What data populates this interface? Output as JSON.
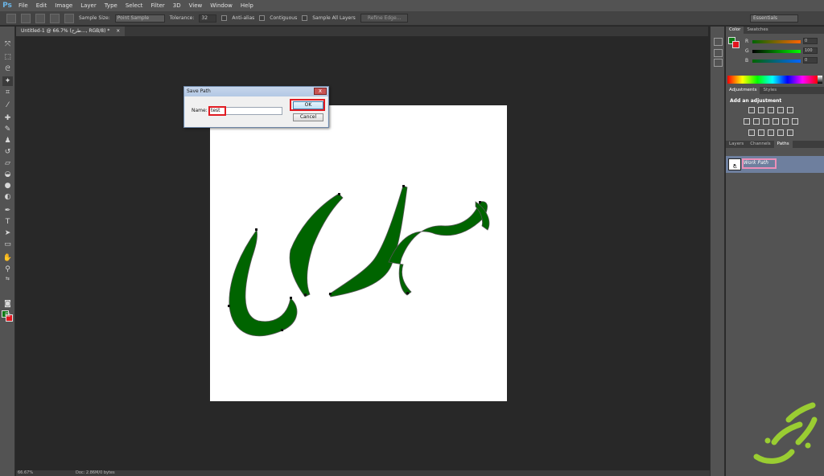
{
  "app": {
    "logo": "Ps",
    "menu": [
      "File",
      "Edit",
      "Image",
      "Layer",
      "Type",
      "Select",
      "Filter",
      "3D",
      "View",
      "Window",
      "Help"
    ]
  },
  "options_bar": {
    "sample_size_label": "Sample Size:",
    "sample_size_value": "Point Sample",
    "tolerance_label": "Tolerance:",
    "tolerance_value": "32",
    "antialias_label": "Anti-alias",
    "contiguous_label": "Contiguous",
    "sample_all_label": "Sample All Layers",
    "refine_edge_label": "Refine Edge...",
    "workspace": "Essentials"
  },
  "document": {
    "tab_title": "Untitled-1 @ 66.7% (طرح..., RGB/8) *",
    "close_glyph": "×",
    "artwork_text": "معماری",
    "artwork_color": "#006400"
  },
  "dialog": {
    "title": "Save Path",
    "close_glyph": "x",
    "name_label": "Name:",
    "name_value": "test",
    "ok_label": "OK",
    "cancel_label": "Cancel"
  },
  "panels": {
    "color_tab": "Color",
    "swatches_tab": "Swatches",
    "r_label": "R",
    "g_label": "G",
    "b_label": "B",
    "r_value": "0",
    "g_value": "100",
    "b_value": "0",
    "adjustments_tab": "Adjustments",
    "styles_tab": "Styles",
    "adjustments_title": "Add an adjustment",
    "layers_tab": "Layers",
    "channels_tab": "Channels",
    "paths_tab": "Paths",
    "work_path_name": "Work Path"
  },
  "status": {
    "zoom": "66.67%",
    "doc_info": "Doc: 2.86M/0 bytes"
  },
  "watermark": {
    "text": "خانه معماری",
    "color": "#9acd32"
  },
  "colors": {
    "foreground": "#0e7a16",
    "background": "#e3141d",
    "highlight": "#e11b22"
  }
}
